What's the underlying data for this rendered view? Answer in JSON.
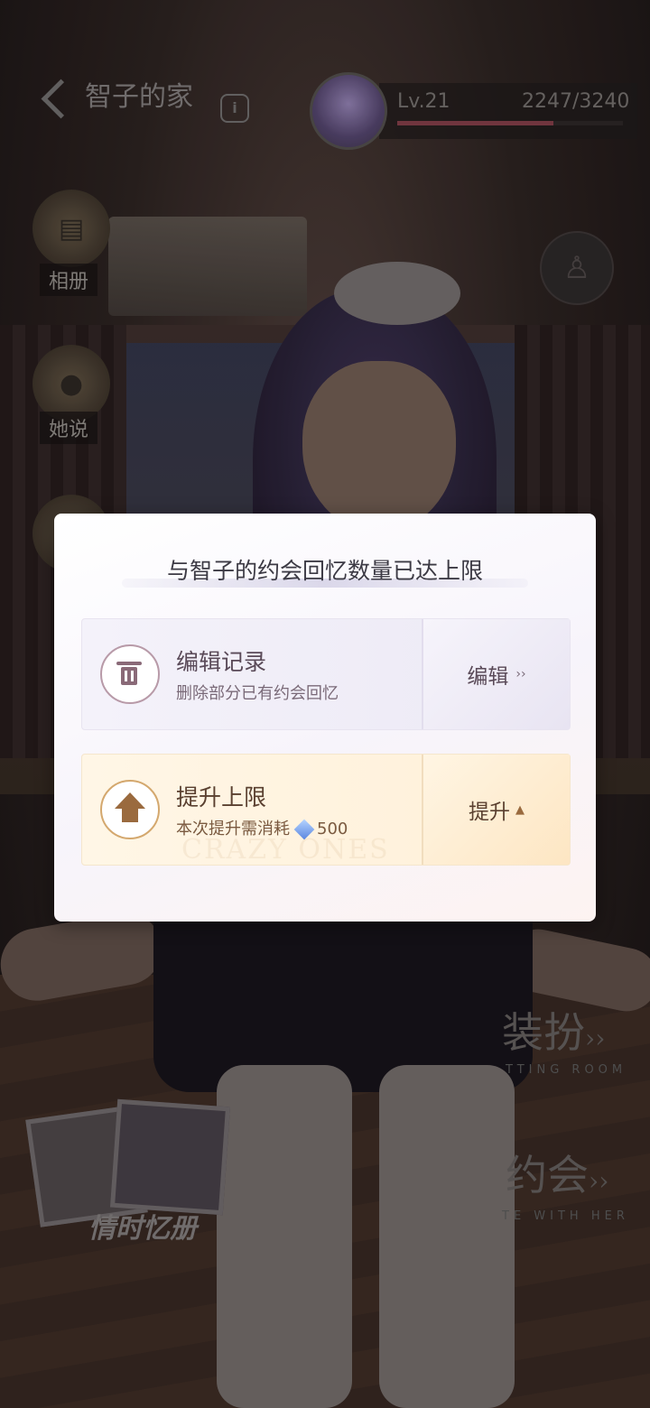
{
  "header": {
    "home_title": "智子的家",
    "info_icon": "info-icon",
    "level": "Lv.21",
    "exp": "2247/3240",
    "exp_progress": 0.69
  },
  "side_buttons": [
    {
      "label": "相册",
      "icon": "album-icon"
    },
    {
      "label": "她说",
      "icon": "microphone-icon"
    }
  ],
  "right_menu": {
    "dressup": "装扮",
    "dressup_sub": "TTING ROOM",
    "date": "约会",
    "date_sub": "TE WITH HER",
    "album": "情时忆册"
  },
  "modal": {
    "title": "与智子的约会回忆数量已达上限",
    "edit_card": {
      "title": "编辑记录",
      "subtitle": "删除部分已有约会回忆",
      "button": "编辑",
      "icon": "trash-icon"
    },
    "upgrade_card": {
      "title": "提升上限",
      "subtitle_prefix": "本次提升需消耗",
      "cost": "500",
      "cost_icon": "diamond-icon",
      "button": "提升",
      "icon": "arrow-up-icon",
      "watermark": "CRAZY ONES"
    }
  }
}
